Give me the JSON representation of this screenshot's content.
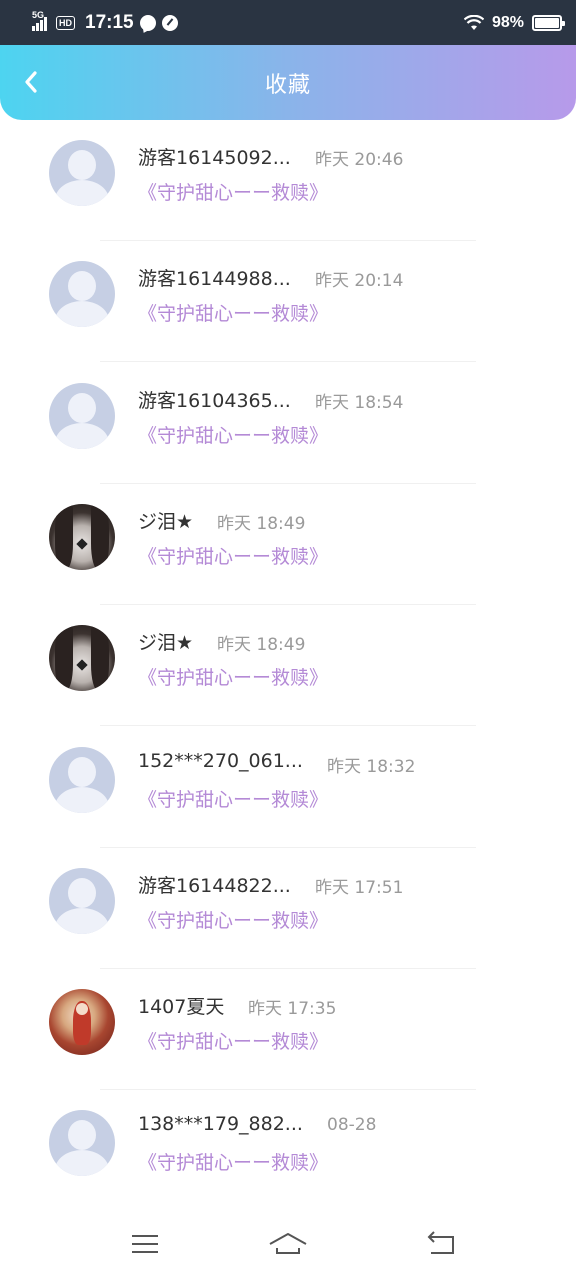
{
  "status_bar": {
    "network": "5G",
    "hd": "HD",
    "time": "17:15",
    "battery_pct": "98%",
    "battery_level": 0.98
  },
  "header": {
    "title": "收藏"
  },
  "favorites": [
    {
      "name": "游客16145092...",
      "time": "昨天 20:46",
      "work": "《守护甜心ーー救赎》",
      "avatar": "default-avatar"
    },
    {
      "name": "游客16144988...",
      "time": "昨天 20:14",
      "work": "《守护甜心ーー救赎》",
      "avatar": "default-avatar"
    },
    {
      "name": "游客16104365...",
      "time": "昨天 18:54",
      "work": "《守护甜心ーー救赎》",
      "avatar": "default-avatar"
    },
    {
      "name": "ジ泪★",
      "time": "昨天 18:49",
      "work": "《守护甜心ーー救赎》",
      "avatar": "photo-avatar-dark"
    },
    {
      "name": "ジ泪★",
      "time": "昨天 18:49",
      "work": "《守护甜心ーー救赎》",
      "avatar": "photo-avatar-dark"
    },
    {
      "name": "152***270_061...",
      "time": "昨天 18:32",
      "work": "《守护甜心ーー救赎》",
      "avatar": "default-avatar"
    },
    {
      "name": "游客16144822...",
      "time": "昨天 17:51",
      "work": "《守护甜心ーー救赎》",
      "avatar": "default-avatar"
    },
    {
      "name": "1407夏天",
      "time": "昨天 17:35",
      "work": "《守护甜心ーー救赎》",
      "avatar": "photo-avatar-red"
    },
    {
      "name": "138***179_882...",
      "time": "08-28",
      "work": "《守护甜心ーー救赎》",
      "avatar": "default-avatar"
    }
  ],
  "nav_bar": {
    "icons": [
      "menu-icon",
      "home-icon",
      "back-icon"
    ]
  },
  "colors": {
    "header_gradient_start": "#4dd4f0",
    "header_gradient_end": "#b79aea",
    "work_title": "#b48ad6",
    "status_bar": "#2a3442"
  }
}
